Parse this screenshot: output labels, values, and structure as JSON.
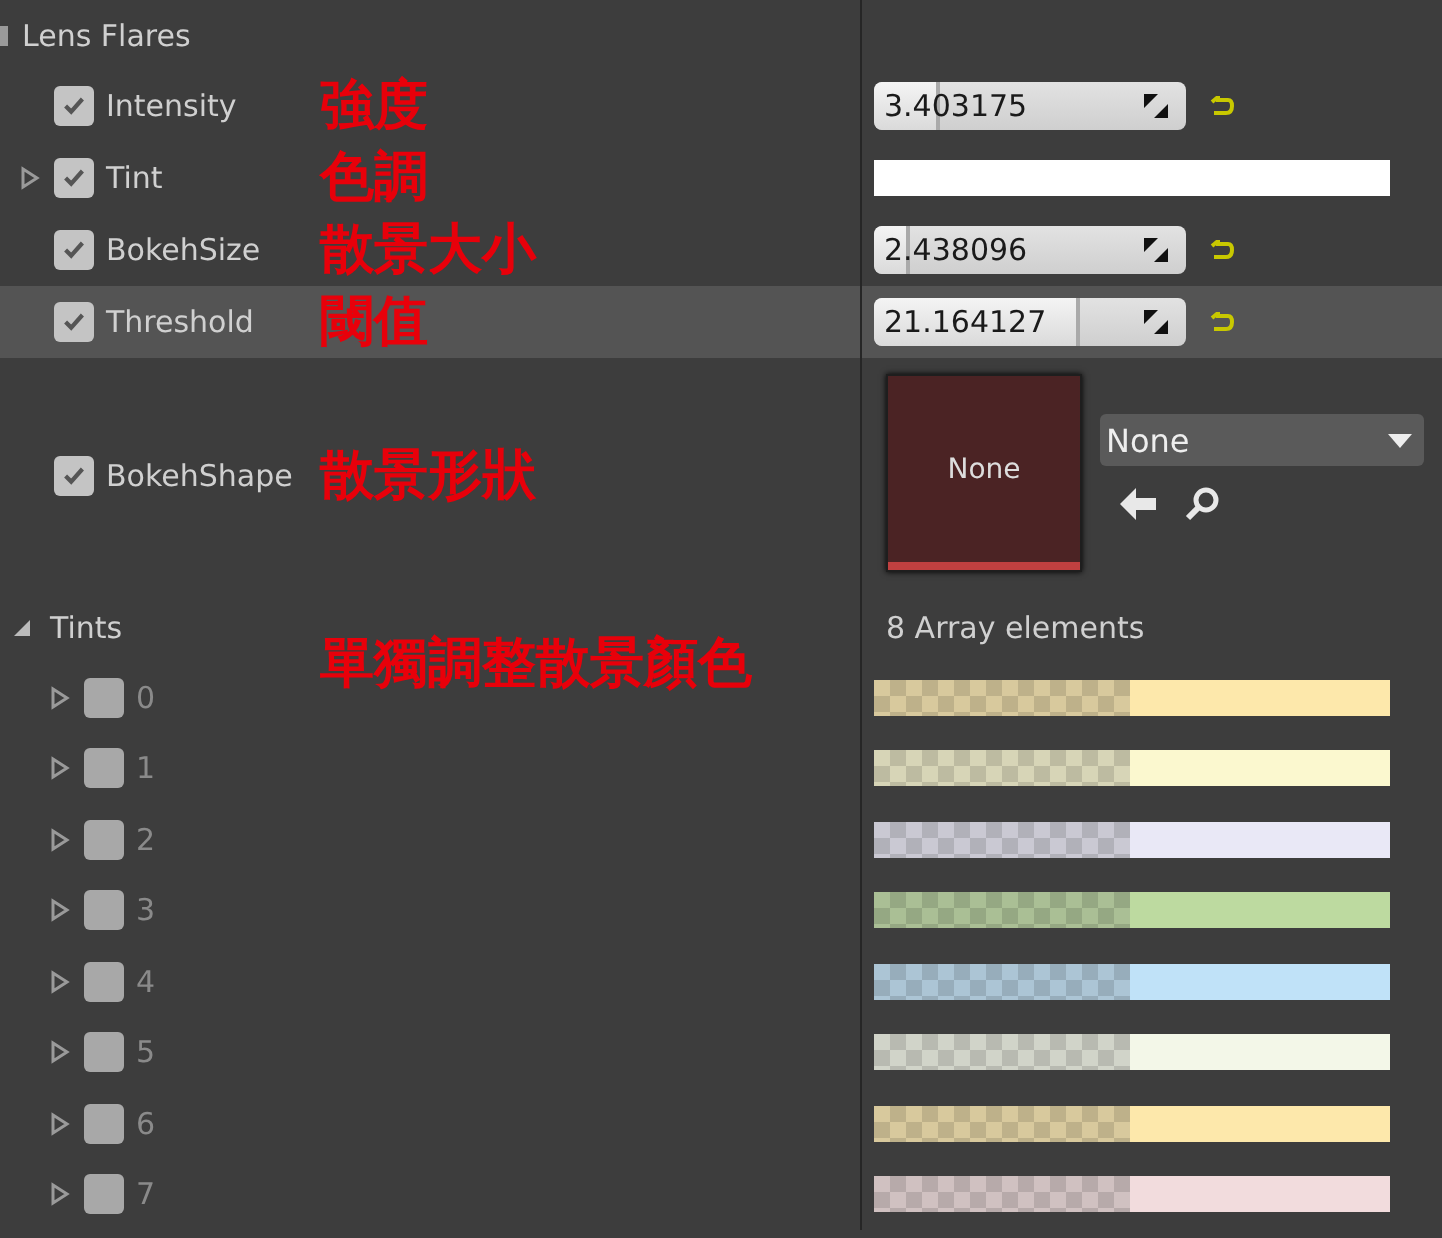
{
  "section": {
    "title": "Lens Flares"
  },
  "properties": [
    {
      "kind": "slider",
      "label": "Intensity",
      "checked": true,
      "annotation": "強度",
      "value": "3.403175",
      "level": 0.2,
      "selected": false
    },
    {
      "kind": "color",
      "label": "Tint",
      "checked": true,
      "annotation": "色調",
      "color": "#ffffff",
      "selected": false
    },
    {
      "kind": "slider",
      "label": "BokehSize",
      "checked": true,
      "annotation": "散景大小",
      "value": "2.438096",
      "level": 0.1,
      "selected": false
    },
    {
      "kind": "slider",
      "label": "Threshold",
      "checked": true,
      "annotation": "閾值",
      "value": "21.164127",
      "level": 0.65,
      "selected": true
    },
    {
      "kind": "asset",
      "label": "BokehShape",
      "checked": true,
      "annotation": "散景形狀",
      "thumbnail": "None",
      "selection": "None",
      "selected": false
    }
  ],
  "tints": {
    "label": "Tints",
    "expanded": true,
    "count": "8 Array elements",
    "annotation": "單獨調整散景顏色",
    "elements": [
      {
        "index": "0",
        "checked": false,
        "color": "#fde8ab"
      },
      {
        "index": "1",
        "checked": false,
        "color": "#fbf8cf"
      },
      {
        "index": "2",
        "checked": false,
        "color": "#e9e8f6"
      },
      {
        "index": "3",
        "checked": false,
        "color": "#bddaa0"
      },
      {
        "index": "4",
        "checked": false,
        "color": "#c0e2f8"
      },
      {
        "index": "5",
        "checked": false,
        "color": "#f3f7e8"
      },
      {
        "index": "6",
        "checked": false,
        "color": "#fde8ab"
      },
      {
        "index": "7",
        "checked": false,
        "color": "#f2dcdd"
      }
    ]
  }
}
